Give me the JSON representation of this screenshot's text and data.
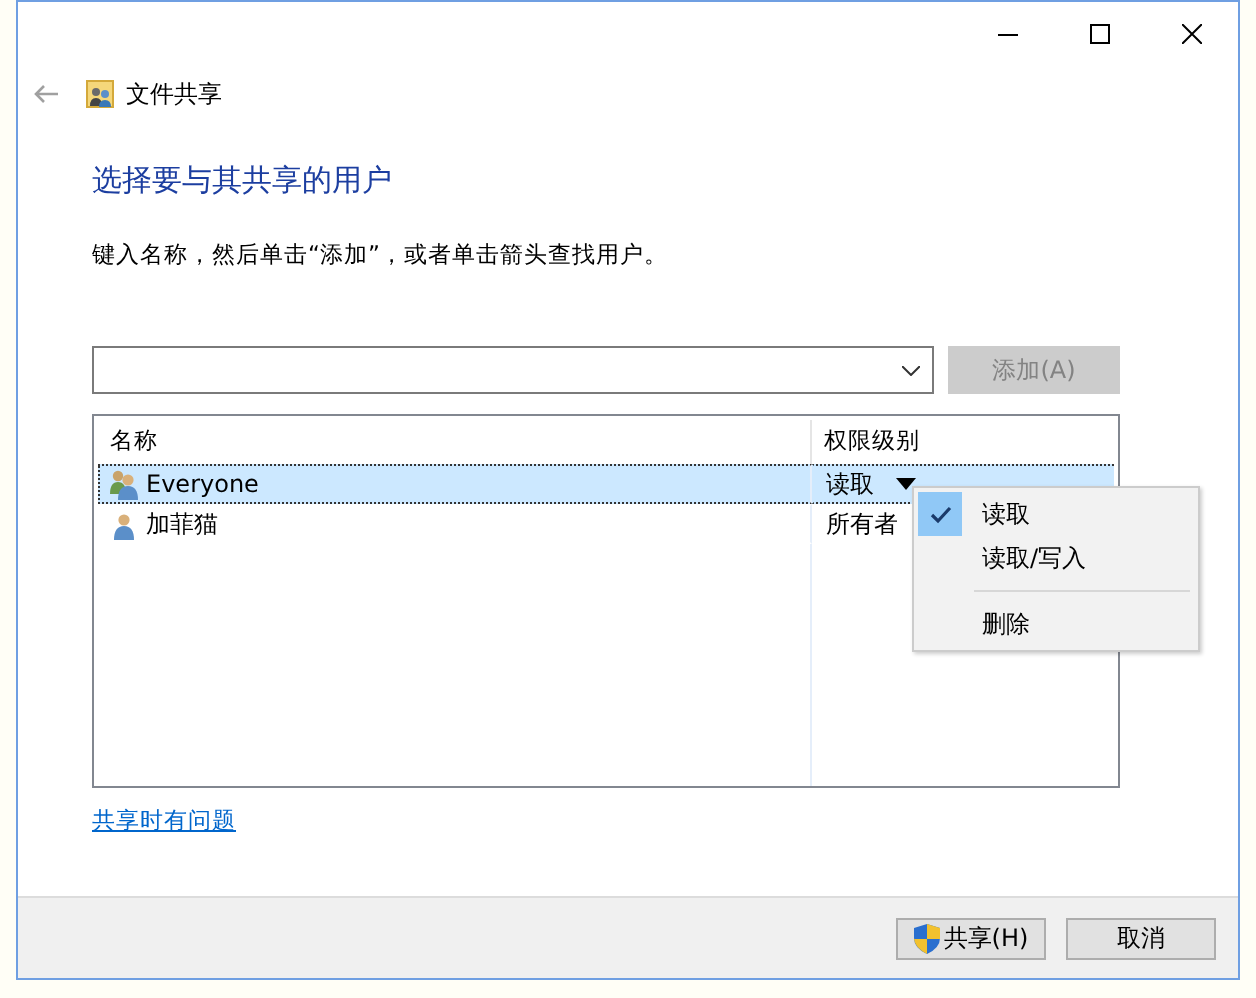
{
  "window": {
    "title": "文件共享"
  },
  "heading": "选择要与其共享的用户",
  "instruction": "键入名称，然后单击“添加”，或者单击箭头查找用户。",
  "add_button": {
    "label": "添加(A)",
    "disabled": true
  },
  "table": {
    "columns": [
      "名称",
      "权限级别"
    ],
    "rows": [
      {
        "name": "Everyone",
        "permission": "读取",
        "kind": "group",
        "selected": true
      },
      {
        "name": "加菲猫",
        "permission": "所有者",
        "kind": "user",
        "selected": false
      }
    ]
  },
  "permission_menu": {
    "items": [
      {
        "label": "读取",
        "kind": "option",
        "checked": true
      },
      {
        "label": "读取/写入",
        "kind": "option",
        "checked": false
      },
      {
        "label": "删除",
        "kind": "action",
        "checked": false
      }
    ]
  },
  "help_link": "共享时有问题",
  "buttons": [
    {
      "label": "共享(H)",
      "shield": true
    },
    {
      "label": "取消",
      "shield": false
    }
  ]
}
